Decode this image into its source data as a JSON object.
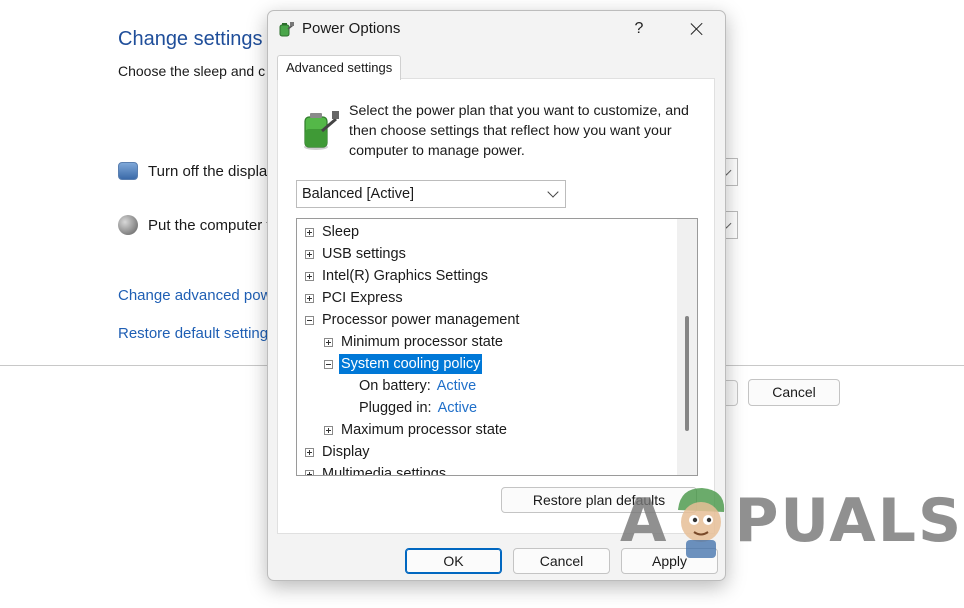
{
  "background": {
    "title": "Change settings f",
    "subtitle": "Choose the sleep and c",
    "display_row_label": "Turn off the displa",
    "sleep_row_label": "Put the computer t",
    "advanced_link": "Change advanced pow",
    "restore_link": "Restore default setting",
    "cancel_label": "Cancel"
  },
  "dialog": {
    "title": "Power Options",
    "help_glyph": "?",
    "tab_label": "Advanced settings",
    "intro_text": "Select the power plan that you want to customize, and then choose settings that reflect how you want your computer to manage power.",
    "plan_value": "Balanced [Active]",
    "tree": {
      "sleep": "Sleep",
      "usb": "USB settings",
      "graphics": "Intel(R) Graphics Settings",
      "pci": "PCI Express",
      "processor": "Processor power management",
      "min_state": "Minimum processor state",
      "cooling": "System cooling policy",
      "on_battery_label": "On battery:",
      "on_battery_value": "Active",
      "plugged_label": "Plugged in:",
      "plugged_value": "Active",
      "max_state": "Maximum processor state",
      "display": "Display",
      "multimedia": "Multimedia settings"
    },
    "restore_button": "Restore plan defaults",
    "ok_button": "OK",
    "cancel_button": "Cancel",
    "apply_button": "Apply"
  },
  "watermark": {
    "left": "A",
    "right": "PUALS"
  },
  "icons": {
    "title": "power-options-icon",
    "battery": "battery-plug-icon",
    "monitor": "monitor-icon",
    "moon": "moon-icon"
  },
  "colors": {
    "accent": "#0078d7",
    "link": "#1f5fb4",
    "value": "#1f6fc9"
  }
}
